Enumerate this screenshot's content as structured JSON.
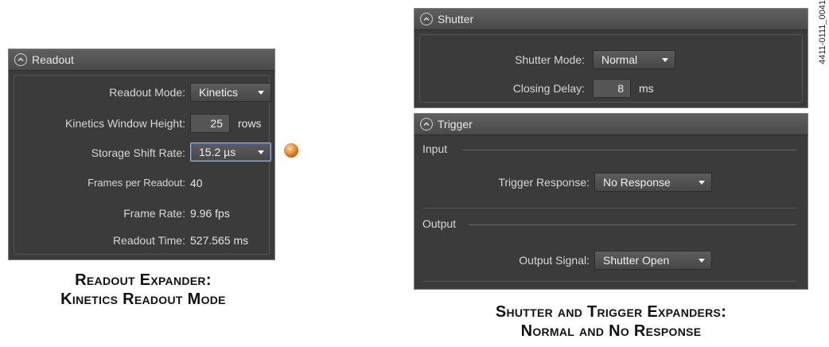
{
  "readout": {
    "title": "Readout",
    "readout_mode_label": "Readout Mode:",
    "readout_mode_value": "Kinetics",
    "kinetics_height_label": "Kinetics Window Height:",
    "kinetics_height_value": "25",
    "kinetics_height_unit": "rows",
    "storage_shift_label": "Storage Shift Rate:",
    "storage_shift_value": "15.2 µs",
    "frames_label": "Frames per Readout:",
    "frames_value": "40",
    "frame_rate_label": "Frame Rate:",
    "frame_rate_value": "9.96 fps",
    "readout_time_label": "Readout Time:",
    "readout_time_value": "527.565 ms"
  },
  "shutter": {
    "title": "Shutter",
    "mode_label": "Shutter Mode:",
    "mode_value": "Normal",
    "delay_label": "Closing Delay:",
    "delay_value": "8",
    "delay_unit": "ms"
  },
  "trigger": {
    "title": "Trigger",
    "input_section": "Input",
    "response_label": "Trigger Response:",
    "response_value": "No Response",
    "output_section": "Output",
    "signal_label": "Output Signal:",
    "signal_value": "Shutter Open"
  },
  "captions": {
    "left_line1": "Readout Expander:",
    "left_line2": "Kinetics Readout Mode",
    "right_line1": "Shutter and Trigger Expanders:",
    "right_line2": "Normal and No Response"
  },
  "figure_id": "4411-0111_0041",
  "icons": {
    "collapse": "chevron-up-icon",
    "storage_indicator": "warning-indicator-icon"
  }
}
